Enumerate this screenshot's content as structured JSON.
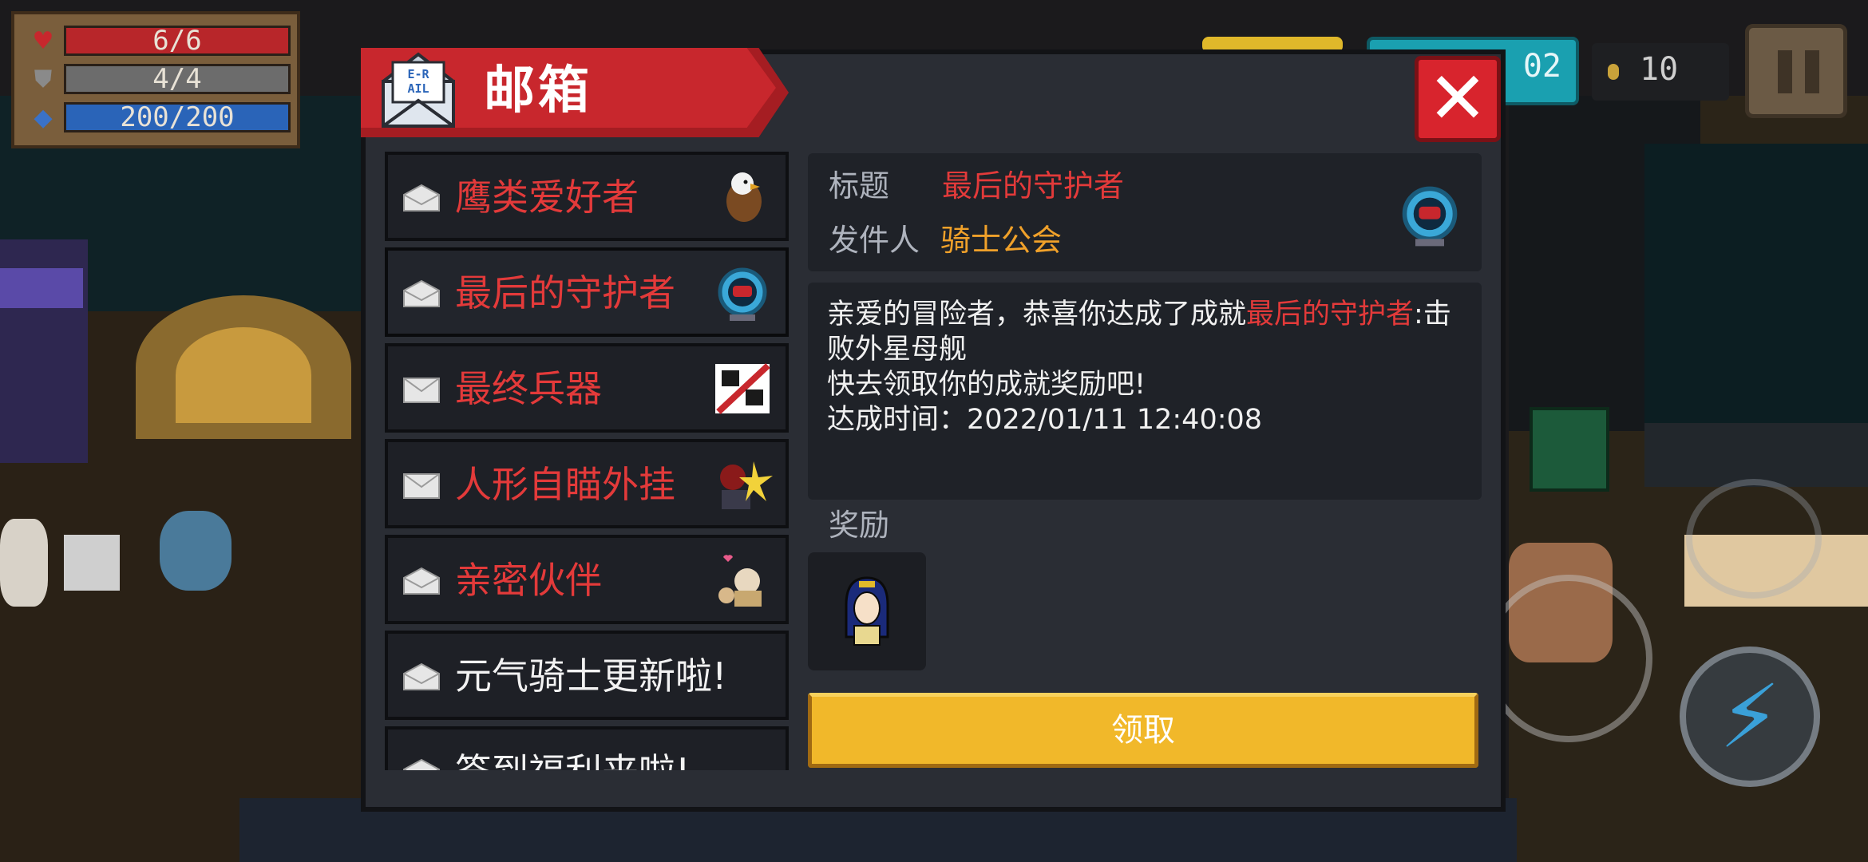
{
  "hud": {
    "health": "6/6",
    "armor": "4/4",
    "energy": "200/200",
    "gems_partial": "02",
    "coins": "10"
  },
  "mailbox": {
    "title": "邮箱",
    "mail_icon_text_top": "E-R",
    "mail_icon_text_bottom": "AIL",
    "items": [
      {
        "title": "鹰类爱好者",
        "read": true,
        "title_color": "#e33a3a",
        "icon": "eagle-icon"
      },
      {
        "title": "最后的守护者",
        "read": true,
        "title_color": "#e33a3a",
        "icon": "guardian-orb-icon"
      },
      {
        "title": "最终兵器",
        "read": false,
        "title_color": "#e33a3a",
        "icon": "final-weapon-icon"
      },
      {
        "title": "人形自瞄外挂",
        "read": false,
        "title_color": "#e33a3a",
        "icon": "aimbot-icon"
      },
      {
        "title": "亲密伙伴",
        "read": true,
        "title_color": "#e33a3a",
        "icon": "partner-icon"
      },
      {
        "title": "元气骑士更新啦!",
        "read": true,
        "title_color": "#f2f2f2",
        "icon": ""
      },
      {
        "title": "签到福利来啦!",
        "read": true,
        "title_color": "#f2f2f2",
        "icon": ""
      }
    ],
    "detail": {
      "title_label": "标题",
      "title_value": "最后的守护者",
      "sender_label": "发件人",
      "sender_value": "骑士公会",
      "body_prefix": "亲爱的冒险者，恭喜你达成了成就",
      "body_achievement": "最后的守护者",
      "body_suffix": ":击败外星母舰",
      "body_line2": "快去领取你的成就奖励吧!",
      "body_line3": "达成时间：2022/01/11 12:40:08",
      "reward_label": "奖励",
      "claim_label": "领取"
    }
  },
  "colors": {
    "accent_red": "#c8272d",
    "text_red": "#e33a3a",
    "sender_orange": "#f0a12a",
    "claim_yellow": "#f1b82a",
    "panel_bg": "#2a2d34"
  }
}
